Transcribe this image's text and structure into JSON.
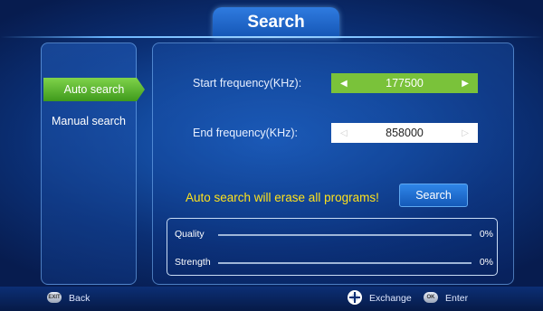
{
  "header": {
    "title": "Search"
  },
  "menu": {
    "items": [
      {
        "label": "Auto search",
        "active": true
      },
      {
        "label": "Manual search",
        "active": false
      }
    ]
  },
  "form": {
    "start_label": "Start frequency(KHz):",
    "start_value": "177500",
    "end_label": "End frequency(KHz):",
    "end_value": "858000",
    "warning": "Auto search will erase all programs!",
    "search_button": "Search"
  },
  "signal": {
    "quality_label": "Quality",
    "quality_value": "0%",
    "quality_level": 0,
    "strength_label": "Strength",
    "strength_value": "0%",
    "strength_level": 0
  },
  "footer": {
    "back_key": "EXIT",
    "back_label": "Back",
    "exchange_label": "Exchange",
    "ok_key": "OK",
    "enter_label": "Enter"
  },
  "colors": {
    "active_green": "#7ac23a",
    "warning_yellow": "#ffe21c",
    "button_blue": "#1f6fd3"
  }
}
